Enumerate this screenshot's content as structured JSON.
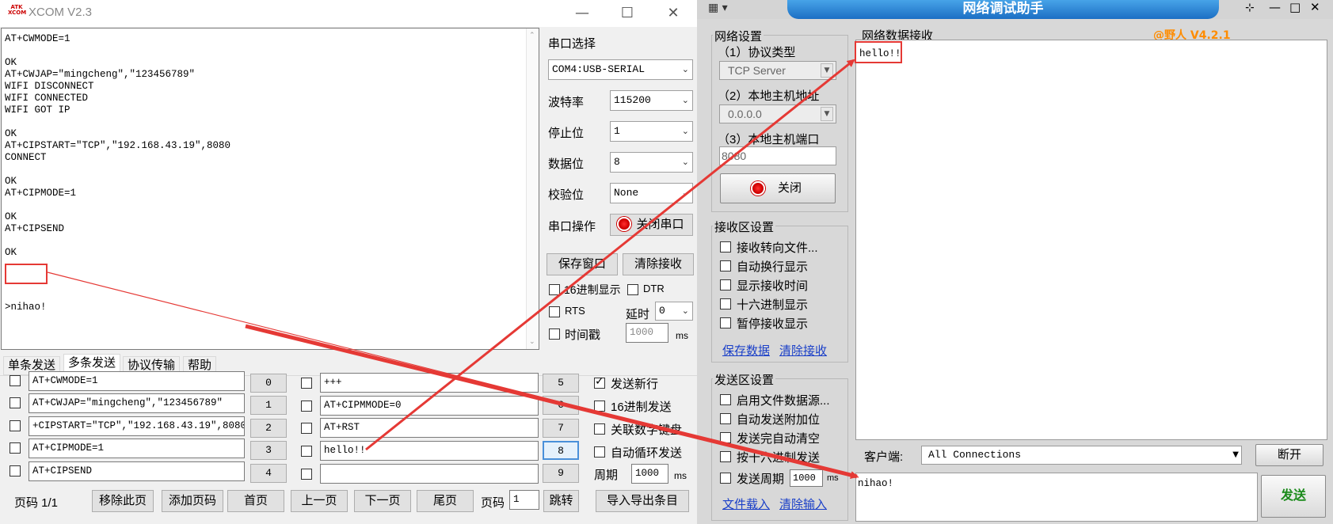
{
  "xcom": {
    "title": "XCOM V2.3",
    "logo_text": "ATK XCOM",
    "receive_lines": "AT+CWMODE=1\n\nOK\nAT+CWJAP=\"mingcheng\",\"123456789\"\nWIFI DISCONNECT\nWIFI CONNECTED\nWIFI GOT IP\n\nOK\nAT+CIPSTART=\"TCP\",\"192.168.43.19\",8080\nCONNECT\n\nOK\nAT+CIPMODE=1\n\nOK\nAT+CIPSEND\n\nOK\n",
    "receive_highlight": ">nihao!",
    "port_select_label": "串口选择",
    "port_value": "COM4:USB-SERIAL",
    "baud_label": "波特率",
    "baud_value": "115200",
    "stop_label": "停止位",
    "stop_value": "1",
    "data_label": "数据位",
    "data_value": "8",
    "parity_label": "校验位",
    "parity_value": "None",
    "port_op_label": "串口操作",
    "close_port_label": "关闭串口",
    "save_window_label": "保存窗口",
    "clear_recv_label": "清除接收",
    "hex_display_label": "16进制显示",
    "dtr_label": "DTR",
    "rts_label": "RTS",
    "delay_label": "延时",
    "delay_value": "0",
    "timestamp_label": "时间戳",
    "timestamp_value": "1000",
    "ms_label": "ms",
    "tabs": [
      "单条发送",
      "多条发送",
      "协议传输",
      "帮助"
    ],
    "commands_left": [
      {
        "text": "AT+CWMODE=1",
        "num": "0"
      },
      {
        "text": "AT+CWJAP=\"mingcheng\",\"123456789\"",
        "num": "1"
      },
      {
        "text": "+CIPSTART=\"TCP\",\"192.168.43.19\",8080",
        "num": "2"
      },
      {
        "text": "AT+CIPMODE=1",
        "num": "3"
      },
      {
        "text": "AT+CIPSEND",
        "num": "4"
      }
    ],
    "commands_right": [
      {
        "text": "+++",
        "num": "5"
      },
      {
        "text": "AT+CIPMMODE=0",
        "num": "6"
      },
      {
        "text": "AT+RST",
        "num": "7"
      },
      {
        "text": "hello!!",
        "num": "8"
      },
      {
        "text": "",
        "num": "9"
      }
    ],
    "send_newline_label": "发送新行",
    "hex_send_label": "16进制发送",
    "link_numpad_label": "关联数字键盘",
    "auto_loop_label": "自动循环发送",
    "period_label": "周期",
    "period_value": "1000",
    "page_label": "页码 1/1",
    "remove_page_label": "移除此页",
    "add_page_label": "添加页码",
    "first_page_label": "首页",
    "prev_page_label": "上一页",
    "next_page_label": "下一页",
    "last_page_label": "尾页",
    "page_input_label": "页码",
    "page_input_value": "1",
    "jump_label": "跳转",
    "import_export_label": "导入导出条目"
  },
  "net": {
    "title": "网络调试助手",
    "version": "@野人 V4.2.1",
    "net_settings_label": "网络设置",
    "protocol_label": "（1）协议类型",
    "protocol_value": "TCP Server",
    "local_ip_label": "（2）本地主机地址",
    "local_ip_value": "0.0.0.0",
    "local_port_label": "（3）本地主机端口",
    "local_port_value": "8080",
    "close_label": "关闭",
    "recv_settings_label": "接收区设置",
    "recv_options": [
      "接收转向文件...",
      "自动换行显示",
      "显示接收时间",
      "十六进制显示",
      "暂停接收显示"
    ],
    "save_data_label": "保存数据",
    "clear_recv_label": "清除接收",
    "send_settings_label": "发送区设置",
    "send_options": [
      "启用文件数据源...",
      "自动发送附加位",
      "发送完自动清空",
      "按十六进制发送"
    ],
    "send_period_label": "发送周期",
    "send_period_value": "1000",
    "ms_label": "ms",
    "file_load_label": "文件载入",
    "clear_input_label": "清除输入",
    "recv_area_label": "网络数据接收",
    "recv_text": "hello!!",
    "client_label": "客户端:",
    "client_value": "All Connections",
    "disconnect_label": "断开",
    "send_text": "nihao!",
    "send_label": "发送"
  },
  "colors": {
    "highlight": "#e53935",
    "link": "#1a3fc8",
    "send_green": "#1a8a1a",
    "version_orange": "#ff8c00"
  }
}
